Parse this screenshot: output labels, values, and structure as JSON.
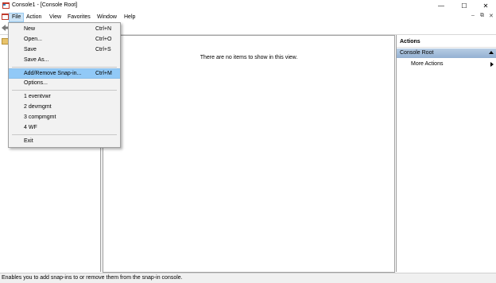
{
  "window": {
    "title": "Console1 - [Console Root]",
    "minimize_glyph": "—",
    "maximize_glyph": "☐",
    "close_glyph": "✕"
  },
  "menubar": {
    "items": [
      "File",
      "Action",
      "View",
      "Favorites",
      "Window",
      "Help"
    ],
    "mdi_controls": [
      "–",
      "⧉",
      "✕"
    ]
  },
  "file_menu": {
    "items": [
      {
        "label": "New",
        "shortcut": "Ctrl+N"
      },
      {
        "label": "Open...",
        "shortcut": "Ctrl+O"
      },
      {
        "label": "Save",
        "shortcut": "Ctrl+S"
      },
      {
        "label": "Save As...",
        "shortcut": ""
      },
      {
        "label": "Add/Remove Snap-in...",
        "shortcut": "Ctrl+M"
      },
      {
        "label": "Options...",
        "shortcut": ""
      },
      {
        "label": "1 eventvwr",
        "shortcut": ""
      },
      {
        "label": "2 devmgmt",
        "shortcut": ""
      },
      {
        "label": "3 compmgmt",
        "shortcut": ""
      },
      {
        "label": "4 WF",
        "shortcut": ""
      },
      {
        "label": "Exit",
        "shortcut": ""
      }
    ],
    "highlighted": "Add/Remove Snap-in..."
  },
  "center": {
    "empty_message": "There are no items to show in this view."
  },
  "actions_pane": {
    "header": "Actions",
    "section": "Console Root",
    "items": [
      "More Actions"
    ]
  },
  "statusbar": {
    "text": "Enables you to add snap-ins to or remove them from the snap-in console."
  },
  "colors": {
    "menu_highlight": "#91c9f7",
    "actions_section": "#9fb9d6",
    "menu_active": "#cce4f7"
  }
}
